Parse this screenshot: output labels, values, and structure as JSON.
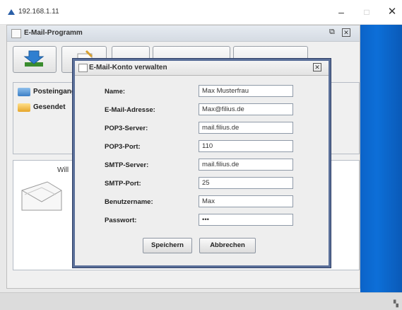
{
  "os_window": {
    "title": "192.168.1.11",
    "minimize": "–",
    "maximize": "□",
    "close": "✕"
  },
  "app_window": {
    "title": "E-Mail-Programm",
    "restore_glyph": "⧉",
    "close_glyph": "✕"
  },
  "folders": [
    {
      "label": "Posteingang",
      "icon": "inbox-icon"
    },
    {
      "label": "Gesendet",
      "icon": "sent-folder-icon"
    }
  ],
  "preview": {
    "text": "Will"
  },
  "dialog": {
    "title": "E-Mail-Konto verwalten",
    "close_glyph": "✕",
    "fields": [
      {
        "label": "Name:",
        "value": "Max Musterfrau"
      },
      {
        "label": "E-Mail-Adresse:",
        "value": "Max@filius.de"
      },
      {
        "label": "POP3-Server:",
        "value": "mail.filius.de"
      },
      {
        "label": "POP3-Port:",
        "value": "110"
      },
      {
        "label": "SMTP-Server:",
        "value": "mail.filius.de"
      },
      {
        "label": "SMTP-Port:",
        "value": "25"
      },
      {
        "label": "Benutzername:",
        "value": "Max"
      },
      {
        "label": "Passwort:",
        "value": "•••"
      }
    ],
    "save_label": "Speichern",
    "cancel_label": "Abbrechen"
  },
  "colors": {
    "dialog_border": "#5a6f99",
    "desktop_accent": "#0b63c8"
  }
}
